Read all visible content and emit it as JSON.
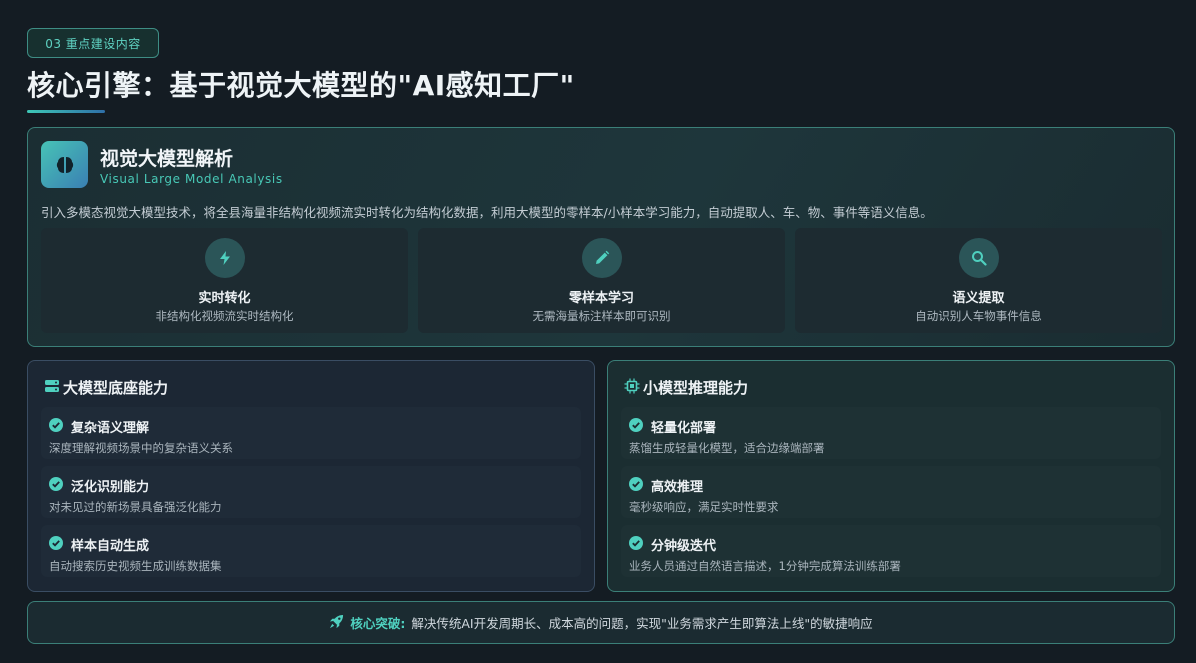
{
  "header": {
    "badge": "03 重点建设内容",
    "title": "核心引擎：基于视觉大模型的\"AI感知工厂\""
  },
  "hero": {
    "icon": "brain-icon",
    "title": "视觉大模型解析",
    "subtitle": "Visual Large Model Analysis",
    "description": "引入多模态视觉大模型技术，将全县海量非结构化视频流实时转化为结构化数据，利用大模型的零样本/小样本学习能力，自动提取人、车、物、事件等语义信息。",
    "features": [
      {
        "icon": "bolt-icon",
        "title": "实时转化",
        "desc": "非结构化视频流实时结构化"
      },
      {
        "icon": "pencil-icon",
        "title": "零样本学习",
        "desc": "无需海量标注样本即可识别"
      },
      {
        "icon": "search-icon",
        "title": "语义提取",
        "desc": "自动识别人车物事件信息"
      }
    ]
  },
  "left_panel": {
    "icon": "server-icon",
    "title": "大模型底座能力",
    "items": [
      {
        "title": "复杂语义理解",
        "desc": "深度理解视频场景中的复杂语义关系"
      },
      {
        "title": "泛化识别能力",
        "desc": "对未见过的新场景具备强泛化能力"
      },
      {
        "title": "样本自动生成",
        "desc": "自动搜索历史视频生成训练数据集"
      }
    ]
  },
  "right_panel": {
    "icon": "chip-icon",
    "title": "小模型推理能力",
    "items": [
      {
        "title": "轻量化部署",
        "desc": "蒸馏生成轻量化模型，适合边缘端部署"
      },
      {
        "title": "高效推理",
        "desc": "毫秒级响应，满足实时性要求"
      },
      {
        "title": "分钟级迭代",
        "desc": "业务人员通过自然语言描述，1分钟完成算法训练部署"
      }
    ]
  },
  "footer": {
    "icon": "rocket-icon",
    "label": "核心突破:",
    "text": "解决传统AI开发周期长、成本高的问题，实现\"业务需求产生即算法上线\"的敏捷响应"
  },
  "colors": {
    "accent": "#4fd0bf",
    "background": "#141c23"
  }
}
